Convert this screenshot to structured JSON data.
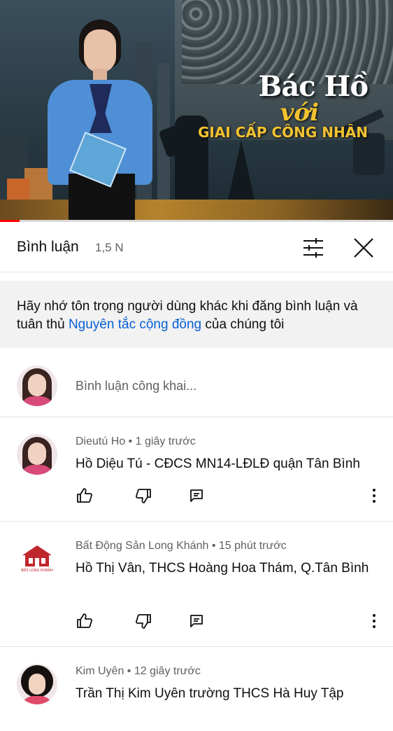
{
  "video": {
    "title_line1": "Bác Hồ",
    "title_line2": "với",
    "title_line3": "GIAI CẤP CÔNG NHÂN",
    "progress": 0.05,
    "progress_color": "#ff0000"
  },
  "comments_panel": {
    "title": "Bình luận",
    "count": "1,5 N",
    "filter_icon": "sort-filter-icon",
    "close_icon": "close-icon"
  },
  "notice": {
    "text_before": "Hãy nhớ tôn trọng người dùng khác khi đăng bình luận và tuân thủ ",
    "link_text": "Nguyên tắc cộng đồng",
    "text_after": " của chúng tôi",
    "link_color": "#065fd4"
  },
  "add_comment": {
    "placeholder": "Bình luận công khai..."
  },
  "comments": [
    {
      "author": "Dieutú Ho",
      "time": "1 giây trước",
      "text": "Hồ Diệu Tú - CĐCS MN14-LĐLĐ quận Tân Bình"
    },
    {
      "author": "Bất Động Sản Long Khánh",
      "time": "15 phút trước",
      "text": "Hồ Thị Vân, THCS Hoàng Hoa Thám, Q.Tân Bình",
      "avatar_logo_text": "BĐS LONG KHÁNH"
    },
    {
      "author": "Kim Uyên",
      "time": "12 giây trước",
      "text": "Trần Thị Kim Uyên trường THCS Hà Huy Tập"
    }
  ],
  "actions": {
    "like_icon": "thumb-up-icon",
    "dislike_icon": "thumb-down-icon",
    "reply_icon": "reply-icon",
    "more_icon": "more-vert-icon"
  }
}
